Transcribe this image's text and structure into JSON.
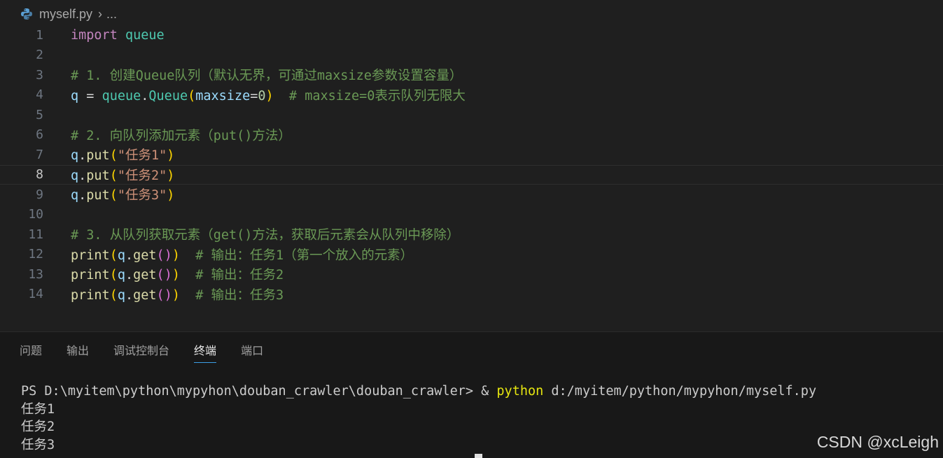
{
  "breadcrumb": {
    "file": "myself.py",
    "more": "..."
  },
  "editor": {
    "active_line": 8,
    "lines": [
      {
        "n": "1"
      },
      {
        "n": "2"
      },
      {
        "n": "3"
      },
      {
        "n": "4"
      },
      {
        "n": "5"
      },
      {
        "n": "6"
      },
      {
        "n": "7"
      },
      {
        "n": "8"
      },
      {
        "n": "9"
      },
      {
        "n": "10"
      },
      {
        "n": "11"
      },
      {
        "n": "12"
      },
      {
        "n": "13"
      },
      {
        "n": "14"
      }
    ],
    "tokens": {
      "l1_kw": "import",
      "l1_mod": "queue",
      "l3_cmt": "# 1. 创建Queue队列（默认无界，可通过maxsize参数设置容量）",
      "l4_q": "q",
      "l4_eq": " = ",
      "l4_mod": "queue",
      "l4_dot": ".",
      "l4_cls": "Queue",
      "l4_lp": "(",
      "l4_arg": "maxsize",
      "l4_as": "=",
      "l4_num": "0",
      "l4_rp": ")",
      "l4_cmt": "  # maxsize=0表示队列无限大",
      "l6_cmt": "# 2. 向队列添加元素（put()方法）",
      "l7_q": "q",
      "l7_dot": ".",
      "l7_fn": "put",
      "l7_lp": "(",
      "l7_str": "\"任务1\"",
      "l7_rp": ")",
      "l8_q": "q",
      "l8_dot": ".",
      "l8_fn": "put",
      "l8_lp": "(",
      "l8_str": "\"任务2\"",
      "l8_rp": ")",
      "l9_q": "q",
      "l9_dot": ".",
      "l9_fn": "put",
      "l9_lp": "(",
      "l9_str": "\"任务3\"",
      "l9_rp": ")",
      "l11_cmt": "# 3. 从队列获取元素（get()方法，获取后元素会从队列中移除）",
      "l12_fn": "print",
      "l12_lp": "(",
      "l12_q": "q",
      "l12_dot": ".",
      "l12_get": "get",
      "l12_lp2": "(",
      "l12_rp2": ")",
      "l12_rp": ")",
      "l12_cmt": "  # 输出：任务1（第一个放入的元素）",
      "l13_fn": "print",
      "l13_lp": "(",
      "l13_q": "q",
      "l13_dot": ".",
      "l13_get": "get",
      "l13_lp2": "(",
      "l13_rp2": ")",
      "l13_rp": ")",
      "l13_cmt": "  # 输出：任务2",
      "l14_fn": "print",
      "l14_lp": "(",
      "l14_q": "q",
      "l14_dot": ".",
      "l14_get": "get",
      "l14_lp2": "(",
      "l14_rp2": ")",
      "l14_rp": ")",
      "l14_cmt": "  # 输出：任务3"
    }
  },
  "panel": {
    "tabs": [
      "问题",
      "输出",
      "调试控制台",
      "终端",
      "端口"
    ],
    "active_tab": "终端",
    "terminal": {
      "prompt": "PS D:\\myitem\\python\\mypyhon\\douban_crawler\\douban_crawler> & ",
      "cmd": "python",
      "args": " d:/myitem/python/mypyhon/myself.py",
      "out1": "任务1",
      "out2": "任务2",
      "out3": "任务3"
    }
  },
  "watermark": "CSDN @xcLeigh",
  "colors": {
    "background": "#1f1f1f",
    "keyword": "#c586c0",
    "module": "#4ec9b0",
    "variable": "#9cdcfe",
    "function": "#dcdcaa",
    "string": "#ce9178",
    "comment": "#6a9955",
    "number": "#b5cea8",
    "active_tab_underline": "#3c9ee5"
  }
}
